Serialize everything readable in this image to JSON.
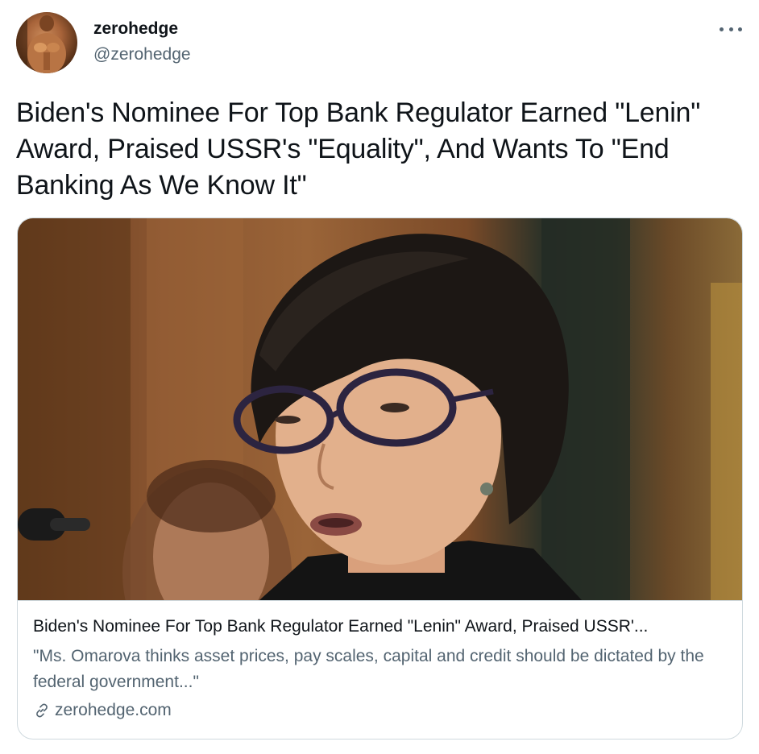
{
  "author": {
    "display_name": "zerohedge",
    "handle": "@zerohedge",
    "avatar_icon": "avatar-photo"
  },
  "menu": {
    "icon": "more-icon"
  },
  "tweet": {
    "text": "Biden's Nominee For Top Bank Regulator Earned \"Lenin\" Award, Praised USSR's \"Equality\", And Wants To \"End Banking As We Know It\""
  },
  "card": {
    "image_icon": "article-photo",
    "title": "Biden's Nominee For Top Bank Regulator Earned \"Lenin\" Award, Praised USSR'...",
    "description": "\"Ms. Omarova thinks asset prices, pay scales, capital and credit should be dictated by the federal government...\"",
    "domain": "zerohedge.com",
    "domain_icon": "link-icon"
  },
  "colors": {
    "text_primary": "#0f1419",
    "text_secondary": "#536471",
    "border": "#cfd9de"
  }
}
